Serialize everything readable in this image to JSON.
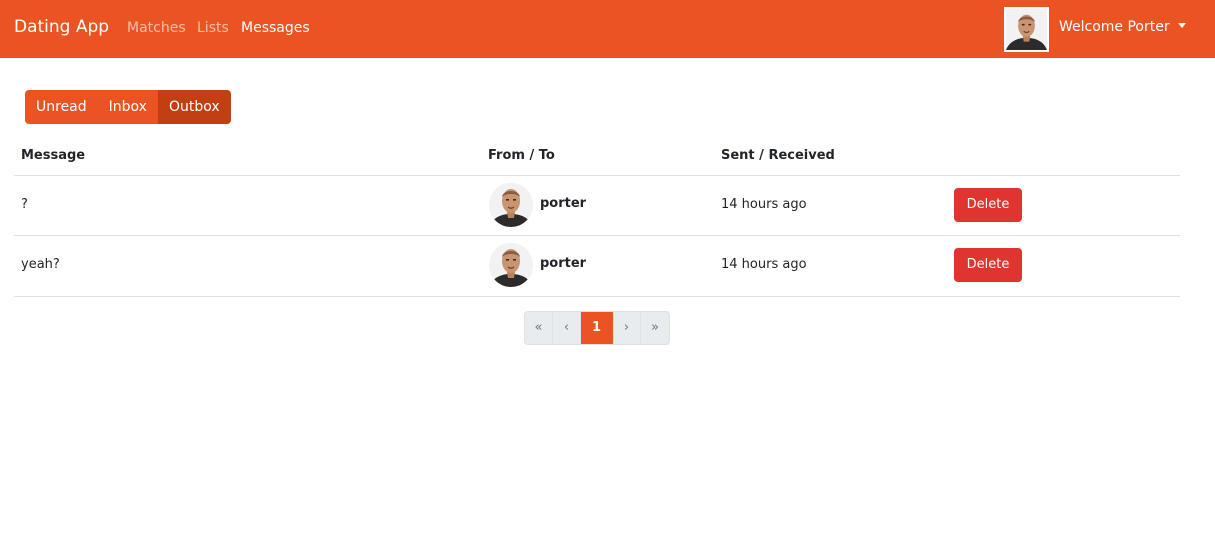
{
  "navbar": {
    "brand": "Dating App",
    "links": [
      {
        "label": "Matches",
        "active": false
      },
      {
        "label": "Lists",
        "active": false
      },
      {
        "label": "Messages",
        "active": true
      }
    ],
    "welcome": "Welcome Porter"
  },
  "tabs": [
    {
      "label": "Unread",
      "active": false
    },
    {
      "label": "Inbox",
      "active": false
    },
    {
      "label": "Outbox",
      "active": true
    }
  ],
  "table": {
    "headers": [
      "Message",
      "From / To",
      "Sent / Received"
    ],
    "rows": [
      {
        "message": "?",
        "user": "porter",
        "when": "14 hours ago",
        "action": "Delete"
      },
      {
        "message": "yeah?",
        "user": "porter",
        "when": "14 hours ago",
        "action": "Delete"
      }
    ]
  },
  "pagination": {
    "first": "«",
    "prev": "‹",
    "current": "1",
    "next": "›",
    "last": "»"
  },
  "colors": {
    "primary": "#eb5422",
    "primary_active": "#c23f14",
    "danger": "#e0342e"
  }
}
